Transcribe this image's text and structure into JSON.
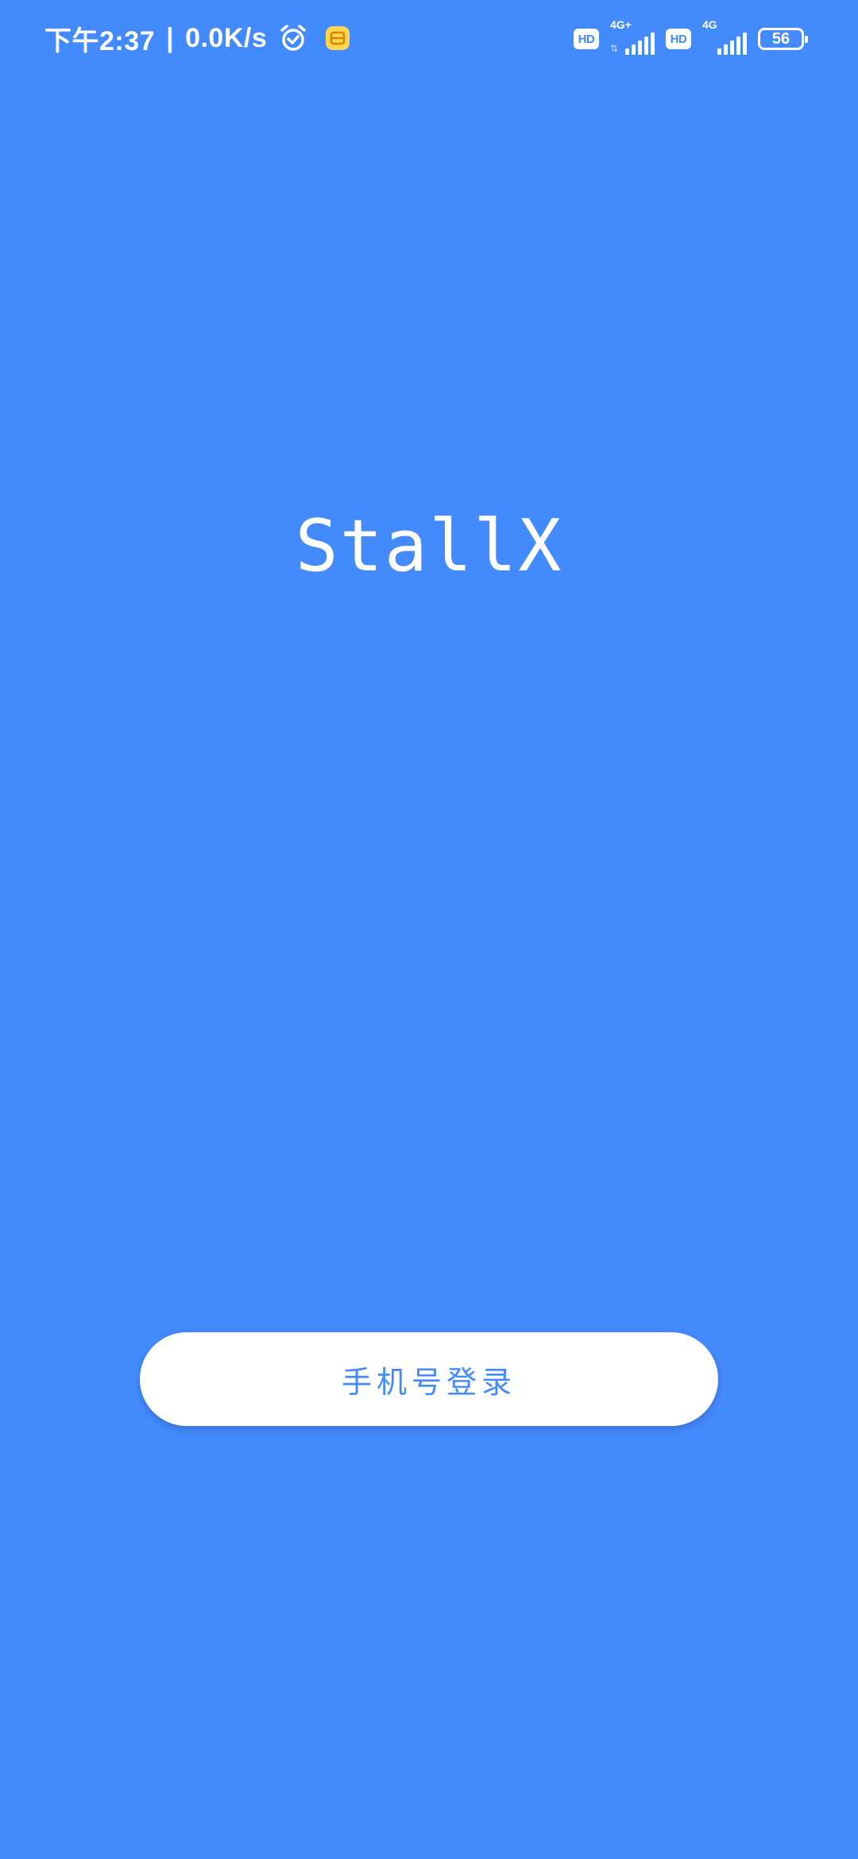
{
  "status_bar": {
    "time": "下午2:37",
    "separator": "|",
    "net_speed": "0.0K/s",
    "alarm_icon": "alarm-clock-icon",
    "app_notification_icon": "message-notification-icon",
    "sim1": {
      "hd_label": "HD",
      "network_type": "4G+",
      "signal_bars": 5
    },
    "sim2": {
      "hd_label": "HD",
      "network_type": "4G",
      "signal_bars": 5
    },
    "battery_level": "56"
  },
  "main": {
    "app_title": "StallX",
    "login_button_label": "手机号登录"
  },
  "colors": {
    "background": "#448aff",
    "button_bg": "#ffffff",
    "button_text": "#448aff",
    "notification_icon": "#ffd54f"
  }
}
